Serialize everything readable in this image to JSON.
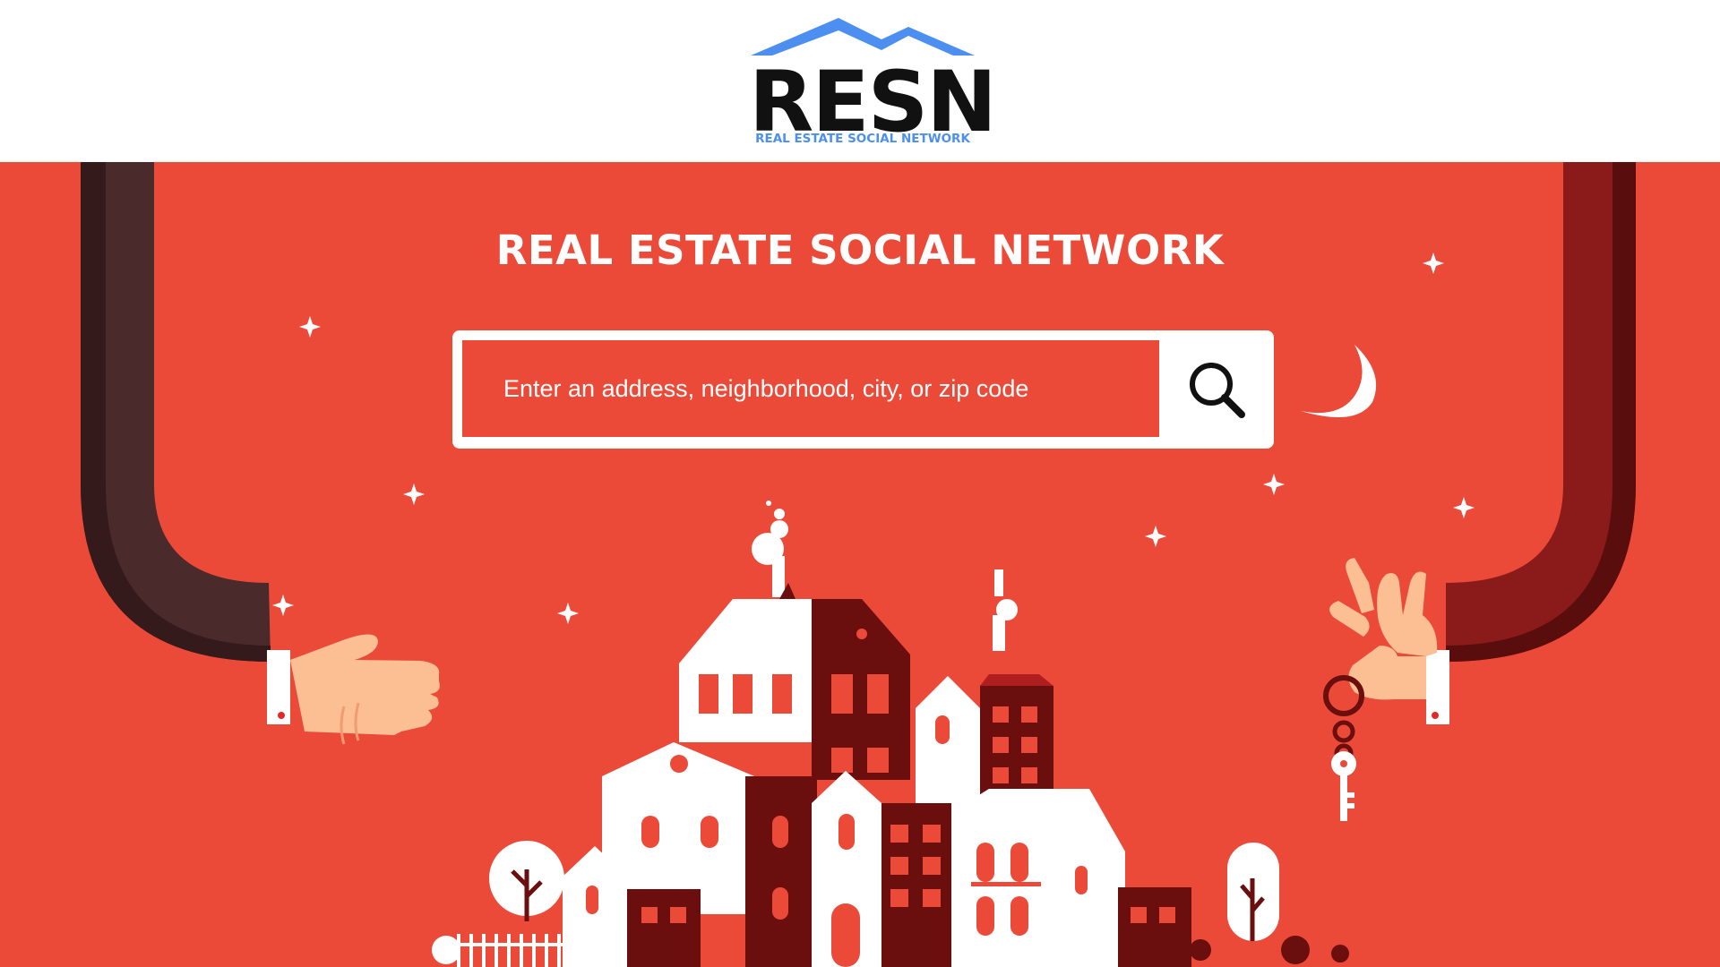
{
  "logo": {
    "wordmark": "RESN",
    "tagline": "REAL ESTATE SOCIAL NETWORK"
  },
  "hero": {
    "title": "REAL ESTATE SOCIAL NETWORK"
  },
  "search": {
    "placeholder": "Enter an address, neighborhood, city, or zip code",
    "icon": "search-icon"
  },
  "colors": {
    "hero_background": "#ec4a38",
    "logo_blue": "#4d8ff0",
    "logo_text": "#111111",
    "dark_red": "#6b0e0e",
    "white": "#ffffff"
  },
  "illustration": {
    "icons": [
      "left-hand-icon",
      "right-hand-icon",
      "house-key-icon",
      "moon-icon",
      "star-icon",
      "house-icon",
      "tree-icon"
    ]
  }
}
